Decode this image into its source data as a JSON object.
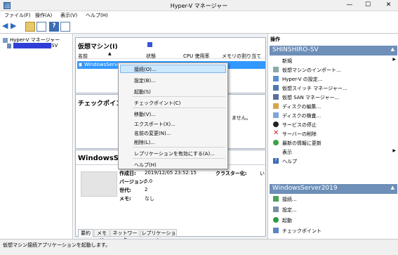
{
  "window": {
    "title": "Hyper-V マネージャー",
    "min": "—",
    "max": "☐",
    "close": "✕"
  },
  "menu": [
    "ファイル(F)",
    "操作(A)",
    "表示(V)",
    "ヘルプ(H)"
  ],
  "tree": {
    "root": "Hyper-V マネージャー",
    "server_suffix": "SV"
  },
  "vm_pane": {
    "title": "仮想マシン(I)",
    "columns": [
      "名前",
      "状態",
      "CPU 使用率",
      "メモリの割り当て"
    ],
    "row_name": "WindowsServer2"
  },
  "checkpoint_pane": {
    "title": "チェックポイント(",
    "partial_text": "ません。"
  },
  "details": {
    "title": "WindowsSer",
    "created_label": "作成日:",
    "created_value": "2019/12/05 23:52:15",
    "cluster_label": "クラスター化:",
    "cluster_value": "い",
    "version_label": "バージョン:",
    "version_value": "5.0",
    "generation_label": "世代:",
    "generation_value": "2",
    "memo_label": "メモ:",
    "memo_value": "なし",
    "tabs": [
      "要約",
      "メモリ",
      "ネットワーク",
      "レプリケーション"
    ]
  },
  "context_menu": [
    "接続(O)...",
    "設定(B)...",
    "起動(S)",
    "チェックポイント(C)",
    "移動(V)...",
    "エクスポート(X)...",
    "名前の変更(N)...",
    "削除(L)...",
    "レプリケーションを有効にする(A)...",
    "ヘルプ(H)"
  ],
  "actions": {
    "title": "操作",
    "server_header": "SHINSHIRO-SV",
    "server_items": [
      "新規",
      "仮想マシンのインポート...",
      "Hyper-V の設定...",
      "仮想スイッチ マネージャー...",
      "仮想 SAN マネージャー...",
      "ディスクの編集...",
      "ディスクの検査...",
      "サービスの停止",
      "サーバーの削除",
      "最新の情報に更新",
      "表示",
      "ヘルプ"
    ],
    "vm_header": "WindowsServer2019",
    "vm_items": [
      "接続...",
      "設定...",
      "起動",
      "チェックポイント"
    ]
  },
  "status": "仮想マシン接続アプリケーションを起動します。",
  "colors": {
    "accent": "#6d8fb8",
    "selection": "#3399ff",
    "hover": "#cce8ff"
  }
}
